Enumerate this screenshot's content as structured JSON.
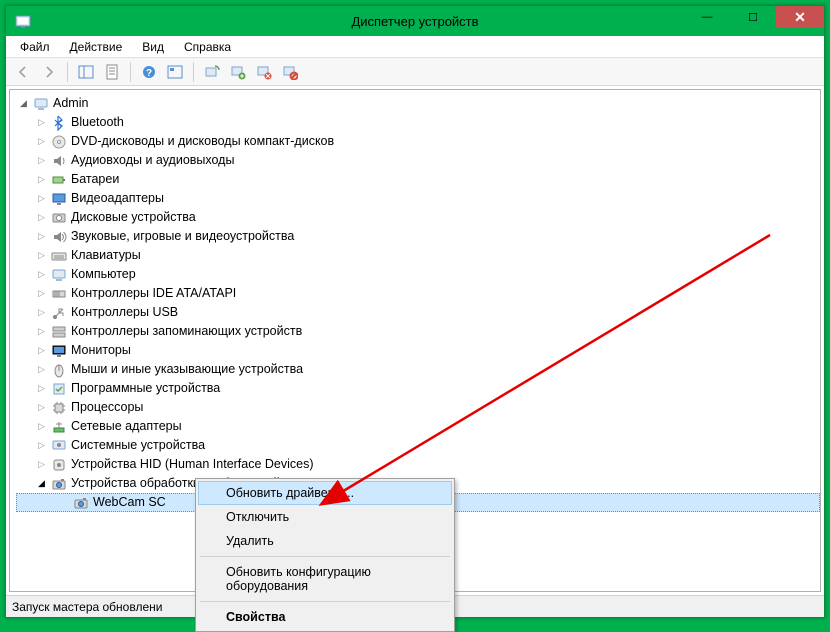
{
  "titlebar": {
    "title": "Диспетчер устройств"
  },
  "menubar": {
    "items": [
      {
        "label": "Файл"
      },
      {
        "label": "Действие"
      },
      {
        "label": "Вид"
      },
      {
        "label": "Справка"
      }
    ]
  },
  "tree": {
    "root": "Admin",
    "categories": [
      {
        "label": "Bluetooth",
        "icon": "bluetooth"
      },
      {
        "label": "DVD-дисководы и дисководы компакт-дисков",
        "icon": "optical"
      },
      {
        "label": "Аудиовходы и аудиовыходы",
        "icon": "audio"
      },
      {
        "label": "Батареи",
        "icon": "battery"
      },
      {
        "label": "Видеоадаптеры",
        "icon": "display"
      },
      {
        "label": "Дисковые устройства",
        "icon": "hdd"
      },
      {
        "label": "Звуковые, игровые и видеоустройства",
        "icon": "sound"
      },
      {
        "label": "Клавиатуры",
        "icon": "keyboard"
      },
      {
        "label": "Компьютер",
        "icon": "computer"
      },
      {
        "label": "Контроллеры IDE ATA/ATAPI",
        "icon": "ide"
      },
      {
        "label": "Контроллеры USB",
        "icon": "usb"
      },
      {
        "label": "Контроллеры запоминающих устройств",
        "icon": "storagectrl"
      },
      {
        "label": "Мониторы",
        "icon": "monitor"
      },
      {
        "label": "Мыши и иные указывающие устройства",
        "icon": "mouse"
      },
      {
        "label": "Программные устройства",
        "icon": "software"
      },
      {
        "label": "Процессоры",
        "icon": "cpu"
      },
      {
        "label": "Сетевые адаптеры",
        "icon": "network"
      },
      {
        "label": "Системные устройства",
        "icon": "system"
      },
      {
        "label": "Устройства HID (Human Interface Devices)",
        "icon": "hid"
      },
      {
        "label": "Устройства обработки изображений",
        "icon": "imaging",
        "expanded": true,
        "children": [
          {
            "label": "WebCam SC",
            "icon": "webcam",
            "selected": true
          }
        ]
      }
    ]
  },
  "contextmenu": {
    "items": [
      {
        "label": "Обновить драйверы...",
        "hover": true
      },
      {
        "label": "Отключить"
      },
      {
        "label": "Удалить"
      },
      {
        "divider": true
      },
      {
        "label": "Обновить конфигурацию оборудования"
      },
      {
        "divider": true
      },
      {
        "label": "Свойства",
        "bold": true
      }
    ]
  },
  "statusbar": {
    "text": "Запуск мастера обновлени"
  }
}
